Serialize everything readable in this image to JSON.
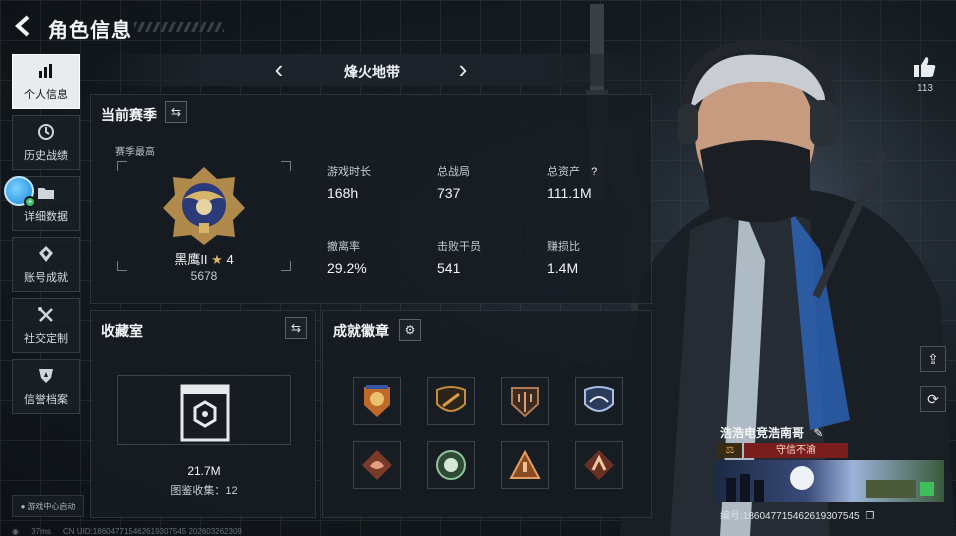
{
  "header": {
    "title": "角色信息"
  },
  "sidebar": {
    "items": [
      {
        "label": "个人信息",
        "icon": "bar-chart-icon",
        "active": true
      },
      {
        "label": "历史战绩",
        "icon": "clock-icon",
        "active": false
      },
      {
        "label": "详细数据",
        "icon": "folder-icon",
        "active": false
      },
      {
        "label": "账号成就",
        "icon": "medal-icon",
        "active": false
      },
      {
        "label": "社交定制",
        "icon": "tools-icon",
        "active": false
      },
      {
        "label": "信誉档案",
        "icon": "shield-icon",
        "active": false
      }
    ],
    "game_center": "游戏中心启动"
  },
  "map_nav": {
    "name": "烽火地带"
  },
  "season": {
    "title": "当前赛季",
    "best_label": "赛季最高",
    "rank_name": "黑鹰II",
    "rank_stars": "4",
    "rank_score": "5678",
    "stats": [
      {
        "label": "游戏时长",
        "value": "168h"
      },
      {
        "label": "总战局",
        "value": "737"
      },
      {
        "label": "总资产",
        "value": "111.1M",
        "help": "?"
      },
      {
        "label": "撤离率",
        "value": "29.2%"
      },
      {
        "label": "击败干员",
        "value": "541"
      },
      {
        "label": "赚损比",
        "value": "1.4M"
      }
    ]
  },
  "collection": {
    "title": "收藏室",
    "value": "21.7M",
    "subtitle": "图鉴收集：12"
  },
  "achievements": {
    "title": "成就徽章",
    "badges": [
      "badge-1",
      "badge-2",
      "badge-3",
      "badge-4",
      "badge-5",
      "badge-6",
      "badge-7",
      "badge-8"
    ]
  },
  "profile": {
    "like_count": "113",
    "player_name": "浩浩电竞浩南哥",
    "credit_text": "守信不渝",
    "player_id": "编号:18604771546261930754​5"
  },
  "status_bar": {
    "ping": "37ms",
    "uid": "CN UID:18604771546261930754​5 202603262309"
  },
  "colors": {
    "accent": "#e9ecee",
    "credit_red": "#7a1d1d",
    "panel_bg": "#161c22"
  }
}
